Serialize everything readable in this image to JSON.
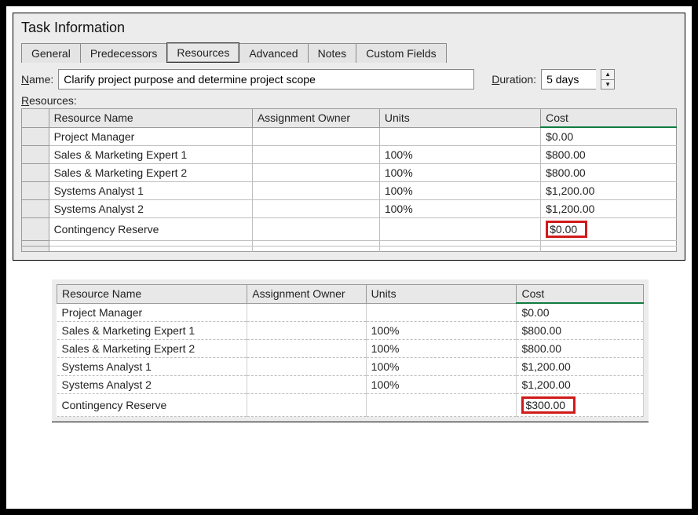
{
  "dialog": {
    "title": "Task Information",
    "tabs": [
      "General",
      "Predecessors",
      "Resources",
      "Advanced",
      "Notes",
      "Custom Fields"
    ],
    "active_tab": "Resources",
    "name_label": "Name:",
    "name_value": "Clarify project purpose and determine project scope",
    "duration_label": "Duration:",
    "duration_value": "5 days",
    "resources_label": "Resources:"
  },
  "grid1": {
    "columns": [
      "Resource Name",
      "Assignment Owner",
      "Units",
      "Cost"
    ],
    "rows": [
      {
        "name": "Project Manager",
        "owner": "",
        "units": "",
        "cost": "$0.00"
      },
      {
        "name": "Sales & Marketing Expert 1",
        "owner": "",
        "units": "100%",
        "cost": "$800.00"
      },
      {
        "name": "Sales & Marketing Expert 2",
        "owner": "",
        "units": "100%",
        "cost": "$800.00"
      },
      {
        "name": "Systems Analyst 1",
        "owner": "",
        "units": "100%",
        "cost": "$1,200.00"
      },
      {
        "name": "Systems Analyst 2",
        "owner": "",
        "units": "100%",
        "cost": "$1,200.00"
      },
      {
        "name": "Contingency Reserve",
        "owner": "",
        "units": "",
        "cost": "$0.00",
        "highlight_cost": true
      }
    ]
  },
  "grid2": {
    "columns": [
      "Resource Name",
      "Assignment Owner",
      "Units",
      "Cost"
    ],
    "rows": [
      {
        "name": "Project Manager",
        "owner": "",
        "units": "",
        "cost": "$0.00"
      },
      {
        "name": "Sales & Marketing Expert 1",
        "owner": "",
        "units": "100%",
        "cost": "$800.00"
      },
      {
        "name": "Sales & Marketing Expert 2",
        "owner": "",
        "units": "100%",
        "cost": "$800.00"
      },
      {
        "name": "Systems Analyst 1",
        "owner": "",
        "units": "100%",
        "cost": "$1,200.00"
      },
      {
        "name": "Systems Analyst 2",
        "owner": "",
        "units": "100%",
        "cost": "$1,200.00"
      },
      {
        "name": "Contingency Reserve",
        "owner": "",
        "units": "",
        "cost": "$300.00",
        "highlight_cost": true
      }
    ]
  }
}
